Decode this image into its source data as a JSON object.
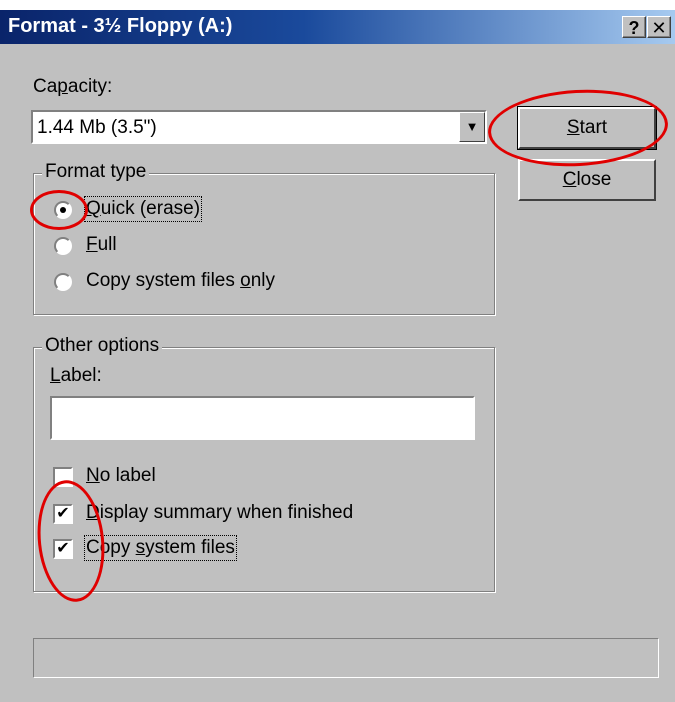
{
  "window": {
    "title": "Format - 3½ Floppy (A:)",
    "help_button": "?",
    "close_button": "✕"
  },
  "capacity": {
    "label_a": "Ca",
    "label_u": "p",
    "label_b": "acity:",
    "value": "1.44 Mb (3.5\")",
    "dropdown_arrow": "▼"
  },
  "buttons": {
    "start_u": "S",
    "start_rest": "tart",
    "close_u": "C",
    "close_rest": "lose"
  },
  "format_type": {
    "legend": "Format type",
    "quick_u": "Q",
    "quick_rest": "uick (erase)",
    "full_u": "F",
    "full_rest": "ull",
    "copy_a": "Copy system files ",
    "copy_u": "o",
    "copy_b": "nly",
    "selected": "Quick (erase)"
  },
  "other_options": {
    "legend": "Other options",
    "label_u": "L",
    "label_rest": "abel:",
    "label_value": "",
    "no_label_u": "N",
    "no_label_rest": "o label",
    "no_label_checked": false,
    "summary_u": "D",
    "summary_rest": "isplay summary when finished",
    "summary_checked": true,
    "sysfiles_a": "Copy ",
    "sysfiles_u": "s",
    "sysfiles_b": "ystem files",
    "sysfiles_checked": true,
    "check_glyph": "✔"
  },
  "colors": {
    "annotation": "#e00000",
    "title_start": "#0a246a",
    "face": "#c0c0c0"
  }
}
